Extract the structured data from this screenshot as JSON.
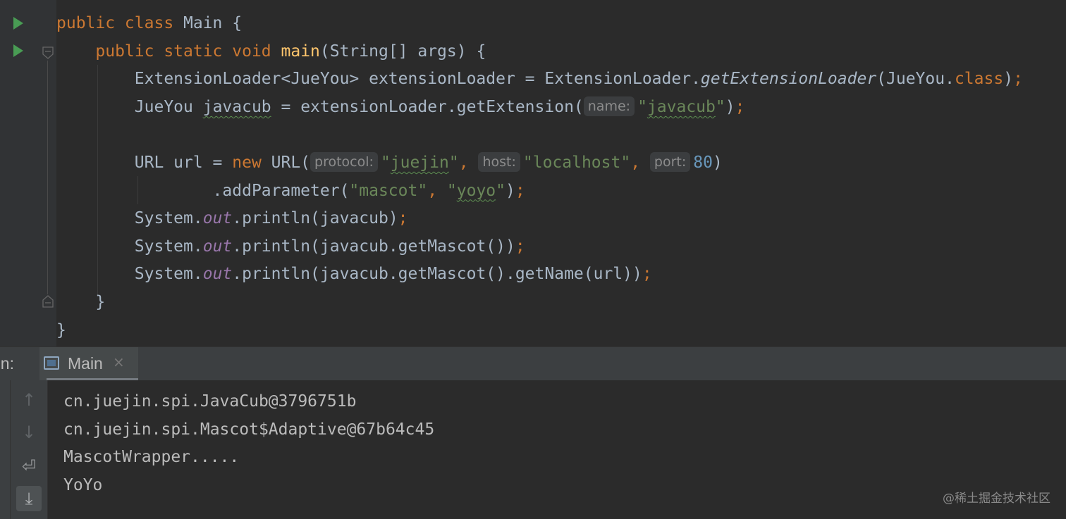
{
  "editor": {
    "lines": [
      {
        "tokens": [
          {
            "t": "public class ",
            "c": "kw"
          },
          {
            "t": "Main {",
            "c": "plain"
          }
        ]
      },
      {
        "tokens": [
          {
            "t": "    ",
            "c": "plain"
          },
          {
            "t": "public static void ",
            "c": "kw"
          },
          {
            "t": "main",
            "c": "fn"
          },
          {
            "t": "(String[] args) {",
            "c": "plain"
          }
        ]
      },
      {
        "tokens": [
          {
            "t": "        ExtensionLoader<JueYou> extensionLoader = ExtensionLoader.",
            "c": "plain"
          },
          {
            "t": "getExtensionLoader",
            "c": "it"
          },
          {
            "t": "(JueYou.",
            "c": "plain"
          },
          {
            "t": "class",
            "c": "kw"
          },
          {
            "t": ")",
            "c": "plain"
          },
          {
            "t": ";",
            "c": "kw"
          }
        ]
      },
      {
        "tokens": [
          {
            "t": "        JueYou ",
            "c": "plain"
          },
          {
            "t": "javacub",
            "c": "squig"
          },
          {
            "t": " = extensionLoader.getExtension(",
            "c": "plain"
          },
          {
            "t": "name:",
            "c": "hint"
          },
          {
            "t": "\"",
            "c": "str"
          },
          {
            "t": "javacub",
            "c": "str squig"
          },
          {
            "t": "\"",
            "c": "str"
          },
          {
            "t": ")",
            "c": "plain"
          },
          {
            "t": ";",
            "c": "kw"
          }
        ]
      },
      {
        "tokens": []
      },
      {
        "tokens": [
          {
            "t": "        URL url = ",
            "c": "plain"
          },
          {
            "t": "new ",
            "c": "kw"
          },
          {
            "t": "URL(",
            "c": "plain"
          },
          {
            "t": "protocol:",
            "c": "hint"
          },
          {
            "t": "\"",
            "c": "str"
          },
          {
            "t": "juejin",
            "c": "str squig"
          },
          {
            "t": "\"",
            "c": "str"
          },
          {
            "t": ", ",
            "c": "kw"
          },
          {
            "t": "host:",
            "c": "hint"
          },
          {
            "t": "\"localhost\"",
            "c": "str"
          },
          {
            "t": ", ",
            "c": "kw"
          },
          {
            "t": "port:",
            "c": "hint"
          },
          {
            "t": "80",
            "c": "num"
          },
          {
            "t": ")",
            "c": "plain"
          }
        ]
      },
      {
        "tokens": [
          {
            "t": "                .addParameter(",
            "c": "plain"
          },
          {
            "t": "\"mascot\"",
            "c": "str"
          },
          {
            "t": ", ",
            "c": "kw"
          },
          {
            "t": "\"",
            "c": "str"
          },
          {
            "t": "yoyo",
            "c": "str squig"
          },
          {
            "t": "\"",
            "c": "str"
          },
          {
            "t": ")",
            "c": "plain"
          },
          {
            "t": ";",
            "c": "kw"
          }
        ]
      },
      {
        "tokens": [
          {
            "t": "        System.",
            "c": "plain"
          },
          {
            "t": "out",
            "c": "field"
          },
          {
            "t": ".println(javacub)",
            "c": "plain"
          },
          {
            "t": ";",
            "c": "kw"
          }
        ]
      },
      {
        "tokens": [
          {
            "t": "        System.",
            "c": "plain"
          },
          {
            "t": "out",
            "c": "field"
          },
          {
            "t": ".println(javacub.getMascot())",
            "c": "plain"
          },
          {
            "t": ";",
            "c": "kw"
          }
        ]
      },
      {
        "tokens": [
          {
            "t": "        System.",
            "c": "plain"
          },
          {
            "t": "out",
            "c": "field"
          },
          {
            "t": ".println(javacub.getMascot().getName(url))",
            "c": "plain"
          },
          {
            "t": ";",
            "c": "kw"
          }
        ]
      },
      {
        "tokens": [
          {
            "t": "    }",
            "c": "plain"
          }
        ]
      },
      {
        "tokens": [
          {
            "t": "}",
            "c": "plain"
          }
        ]
      }
    ]
  },
  "run_panel": {
    "label": "un:",
    "tab_label": "Main",
    "tab_close": "×",
    "tab_icon": "console-window-icon",
    "toolbar": {
      "up_icon": "↑",
      "down_icon": "↓",
      "wrap_icon": "⏎",
      "scroll_end_icon": "⤓"
    }
  },
  "console": {
    "lines": [
      "cn.juejin.spi.JavaCub@3796751b",
      "cn.juejin.spi.Mascot$Adaptive@67b64c45",
      "MascotWrapper.....",
      "YoYo"
    ]
  },
  "watermark": "@稀土掘金技术社区",
  "colors": {
    "keyword": "#cc7832",
    "function": "#ffc66d",
    "string": "#6a8759",
    "number": "#6897bb",
    "field": "#9876aa",
    "text": "#a9b7c6",
    "background": "#2b2b2b"
  }
}
